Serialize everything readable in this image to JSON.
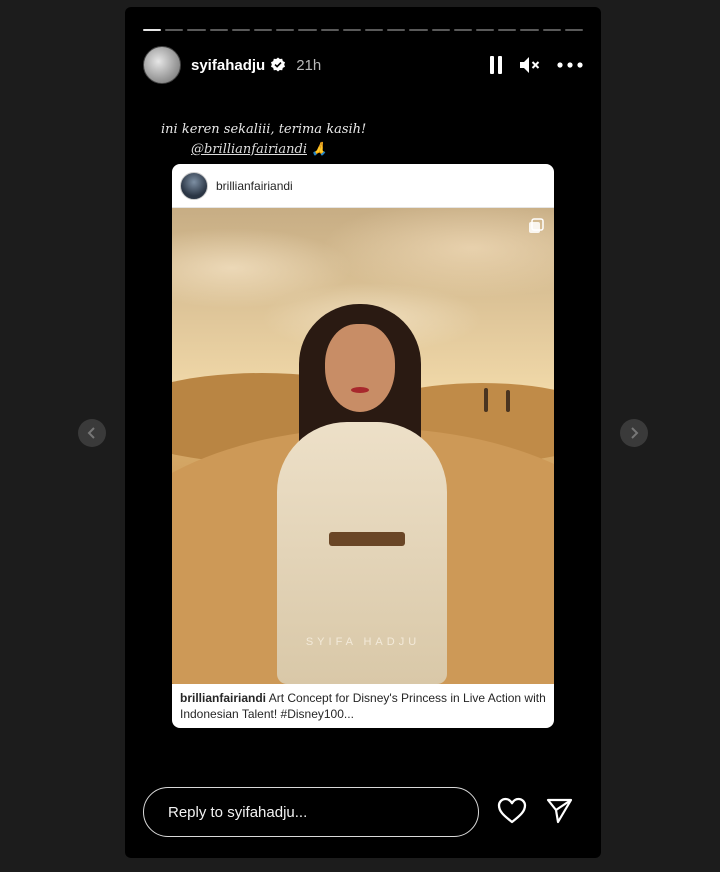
{
  "story": {
    "progress_segments": 20,
    "active_segment": 1,
    "username": "syifahadju",
    "time": "21h",
    "verified": true,
    "icons": {
      "pause": "pause-icon",
      "mute": "mute-icon",
      "more": "more-icon"
    }
  },
  "caption": {
    "line1": "ini keren sekaliii, terima kasih!",
    "mention": "@brillianfairiandi",
    "emoji": "🙏"
  },
  "shared_post": {
    "username": "brillianfairiandi",
    "image_watermark": "SYIFA HADJU",
    "caption_user": "brillianfairiandi",
    "caption_text": "Art Concept for Disney's Princess in Live Action with Indonesian Talent! #Disney100..."
  },
  "footer": {
    "reply_placeholder": "Reply to syifahadju...",
    "icons": {
      "like": "heart-icon",
      "share": "send-icon"
    }
  },
  "colors": {
    "background": "#1c1c1c",
    "story_bg": "#000000",
    "card_bg": "#ffffff"
  }
}
